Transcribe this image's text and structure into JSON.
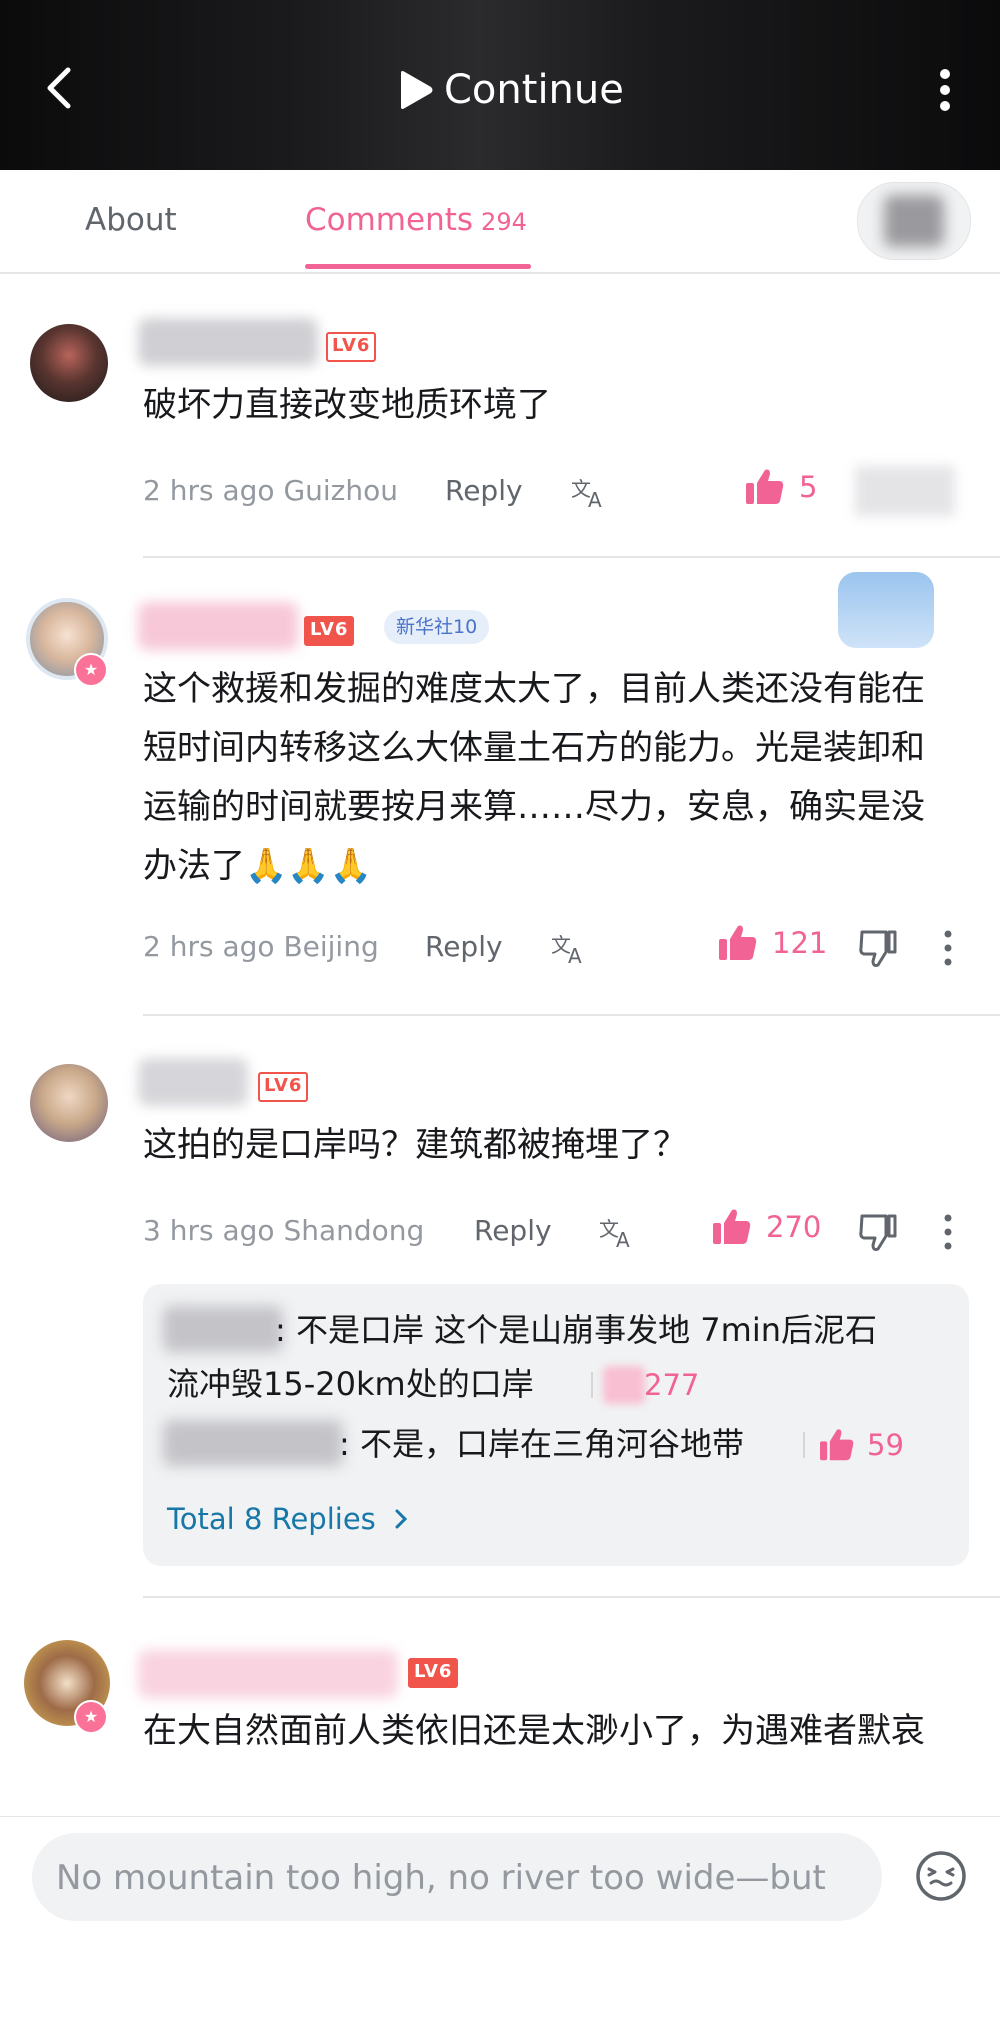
{
  "header": {
    "continue_label": "Continue"
  },
  "tabs": {
    "about": "About",
    "comments": "Comments",
    "comments_count": "294"
  },
  "comments": [
    {
      "level": "LV6",
      "text": "破坏力直接改变地质环境了",
      "time": "2 hrs ago",
      "location": "Guizhou",
      "reply_label": "Reply",
      "likes": "5"
    },
    {
      "level": "LV6",
      "badge": "新华社10",
      "text": "这个救援和发掘的难度太大了，目前人类还没有能在短时间内转移这么大体量土石方的能力。光是装卸和运输的时间就要按月来算……尽力，安息，确实是没办法了🙏🙏🙏",
      "time": "2 hrs ago",
      "location": "Beijing",
      "reply_label": "Reply",
      "likes": "121"
    },
    {
      "level": "LV6",
      "text": "这拍的是口岸吗？建筑都被掩埋了？",
      "time": "3 hrs ago",
      "location": "Shandong",
      "reply_label": "Reply",
      "likes": "270"
    },
    {
      "level": "LV6",
      "text": "在大自然面前人类依旧还是太渺小了，为遇难者默哀"
    }
  ],
  "replies": [
    {
      "text_line1": ": 不是口岸 这个是山崩事发地 7min后泥石",
      "text_line2": "流冲毁15-20km处的口岸",
      "likes": "277"
    },
    {
      "text": ": 不是，口岸在三角河谷地带",
      "likes": "59"
    }
  ],
  "total_replies": "Total 8 Replies",
  "input": {
    "placeholder": "No mountain too high, no river too wide—but"
  },
  "colors": {
    "accent": "#f06394",
    "link": "#1677a8",
    "level": "#f0544b"
  }
}
